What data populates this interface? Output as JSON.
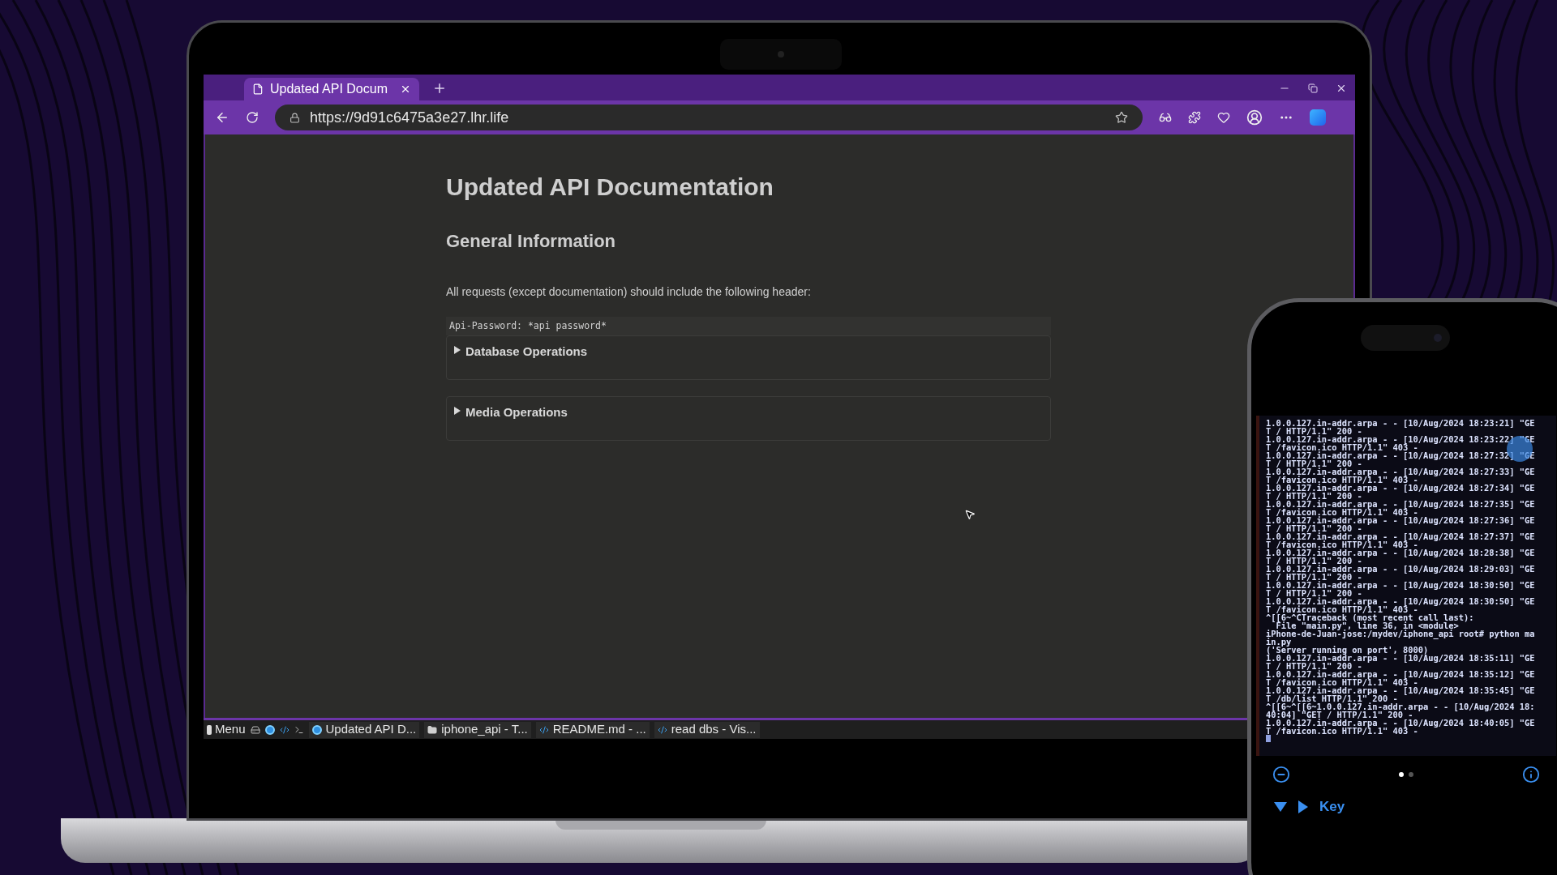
{
  "browser": {
    "tabs": [
      {
        "title": "Updated API Docum",
        "selected": true
      }
    ],
    "url": "https://9d91c6475a3e27.lhr.life"
  },
  "page": {
    "title": "Updated API Documentation",
    "heading": "General Information",
    "paragraph": "All requests (except documentation) should include the following header:",
    "code": "Api-Password: *api password*",
    "sections": [
      {
        "label": "Database Operations",
        "expanded": false
      },
      {
        "label": "Media Operations",
        "expanded": false
      }
    ]
  },
  "taskbar": {
    "menu": "Menu",
    "items": [
      {
        "label": "Updated API D...",
        "kind": "browser"
      },
      {
        "label": "iphone_api - T...",
        "kind": "folder"
      },
      {
        "label": "README.md - ...",
        "kind": "editor"
      },
      {
        "label": "read dbs - Vis...",
        "kind": "editor"
      }
    ]
  },
  "phone": {
    "terminal_lines": [
      "1.0.0.127.in-addr.arpa - - [10/Aug/2024 18:23:21] \"GE",
      "T / HTTP/1.1\" 200 -",
      "1.0.0.127.in-addr.arpa - - [10/Aug/2024 18:23:22] \"GE",
      "T /favicon.ico HTTP/1.1\" 403 -",
      "1.0.0.127.in-addr.arpa - - [10/Aug/2024 18:27:32] \"GE",
      "T / HTTP/1.1\" 200 -",
      "1.0.0.127.in-addr.arpa - - [10/Aug/2024 18:27:33] \"GE",
      "T /favicon.ico HTTP/1.1\" 403 -",
      "1.0.0.127.in-addr.arpa - - [10/Aug/2024 18:27:34] \"GE",
      "T / HTTP/1.1\" 200 -",
      "1.0.0.127.in-addr.arpa - - [10/Aug/2024 18:27:35] \"GE",
      "T /favicon.ico HTTP/1.1\" 403 -",
      "1.0.0.127.in-addr.arpa - - [10/Aug/2024 18:27:36] \"GE",
      "T / HTTP/1.1\" 200 -",
      "1.0.0.127.in-addr.arpa - - [10/Aug/2024 18:27:37] \"GE",
      "T /favicon.ico HTTP/1.1\" 403 -",
      "1.0.0.127.in-addr.arpa - - [10/Aug/2024 18:28:38] \"GE",
      "T / HTTP/1.1\" 200 -",
      "1.0.0.127.in-addr.arpa - - [10/Aug/2024 18:29:03] \"GE",
      "T / HTTP/1.1\" 200 -",
      "1.0.0.127.in-addr.arpa - - [10/Aug/2024 18:30:50] \"GE",
      "T / HTTP/1.1\" 200 -",
      "1.0.0.127.in-addr.arpa - - [10/Aug/2024 18:30:50] \"GE",
      "T /favicon.ico HTTP/1.1\" 403 -",
      "^[[6~^CTraceback (most recent call last):",
      "  File \"main.py\", line 36, in <module>",
      "iPhone-de-Juan-jose:/mydev/iphone_api root# python ma",
      "in.py",
      "('Server running on port', 8000)",
      "1.0.0.127.in-addr.arpa - - [10/Aug/2024 18:35:11] \"GE",
      "T / HTTP/1.1\" 200 -",
      "1.0.0.127.in-addr.arpa - - [10/Aug/2024 18:35:12] \"GE",
      "T /favicon.ico HTTP/1.1\" 403 -",
      "1.0.0.127.in-addr.arpa - - [10/Aug/2024 18:35:45] \"GE",
      "T /db/list HTTP/1.1\" 200 -",
      "^[[6~^[[6~1.0.0.127.in-addr.arpa - - [10/Aug/2024 18:",
      "40:04] \"GET / HTTP/1.1\" 200 -",
      "1.0.0.127.in-addr.arpa - - [10/Aug/2024 18:40:05] \"GE",
      "T /favicon.ico HTTP/1.1\" 403 -"
    ],
    "pages": [
      {
        "selected": true
      },
      {
        "selected": false
      }
    ],
    "key_label": "Key"
  }
}
